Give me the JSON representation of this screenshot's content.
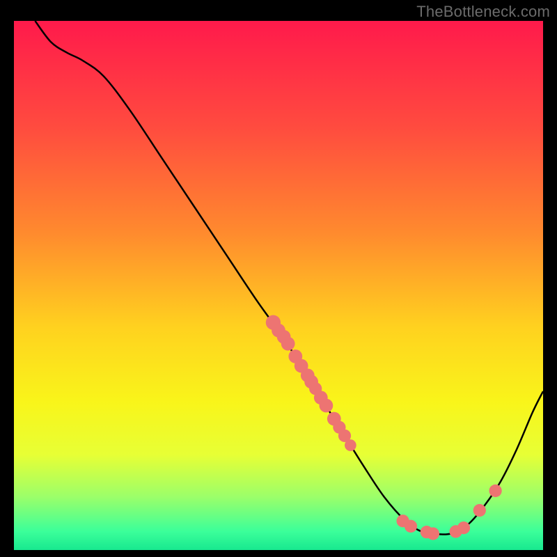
{
  "attribution": "TheBottleneck.com",
  "chart_data": {
    "type": "line",
    "title": "",
    "xlabel": "",
    "ylabel": "",
    "xlim": [
      0,
      100
    ],
    "ylim": [
      0,
      100
    ],
    "background_gradient": {
      "stops": [
        {
          "offset": 0.0,
          "color": "#ff1a4b"
        },
        {
          "offset": 0.2,
          "color": "#ff4b3f"
        },
        {
          "offset": 0.4,
          "color": "#ff8a2e"
        },
        {
          "offset": 0.58,
          "color": "#ffd21f"
        },
        {
          "offset": 0.72,
          "color": "#f9f51a"
        },
        {
          "offset": 0.82,
          "color": "#e7ff35"
        },
        {
          "offset": 0.9,
          "color": "#9bff6a"
        },
        {
          "offset": 0.965,
          "color": "#3bff9a"
        },
        {
          "offset": 1.0,
          "color": "#18e88f"
        }
      ]
    },
    "curve": [
      {
        "x": 4,
        "y": 100
      },
      {
        "x": 7,
        "y": 96
      },
      {
        "x": 10,
        "y": 94
      },
      {
        "x": 13,
        "y": 92.5
      },
      {
        "x": 17,
        "y": 89.5
      },
      {
        "x": 22,
        "y": 83
      },
      {
        "x": 28,
        "y": 74
      },
      {
        "x": 34,
        "y": 65
      },
      {
        "x": 40,
        "y": 56
      },
      {
        "x": 46,
        "y": 47
      },
      {
        "x": 51,
        "y": 40
      },
      {
        "x": 56,
        "y": 32
      },
      {
        "x": 61,
        "y": 24
      },
      {
        "x": 66,
        "y": 16
      },
      {
        "x": 70,
        "y": 10
      },
      {
        "x": 74,
        "y": 5.5
      },
      {
        "x": 77,
        "y": 3.5
      },
      {
        "x": 80,
        "y": 3
      },
      {
        "x": 83,
        "y": 3.2
      },
      {
        "x": 86,
        "y": 5
      },
      {
        "x": 89,
        "y": 8.5
      },
      {
        "x": 92,
        "y": 13
      },
      {
        "x": 95,
        "y": 19
      },
      {
        "x": 98,
        "y": 26
      },
      {
        "x": 100,
        "y": 30
      }
    ],
    "dots": [
      {
        "x": 49.0,
        "y": 43.0,
        "r": 1.4
      },
      {
        "x": 50.0,
        "y": 41.5,
        "r": 1.3
      },
      {
        "x": 51.0,
        "y": 40.3,
        "r": 1.3
      },
      {
        "x": 51.8,
        "y": 39.0,
        "r": 1.3
      },
      {
        "x": 53.2,
        "y": 36.6,
        "r": 1.3
      },
      {
        "x": 54.3,
        "y": 34.8,
        "r": 1.3
      },
      {
        "x": 55.5,
        "y": 33.0,
        "r": 1.3
      },
      {
        "x": 56.2,
        "y": 31.8,
        "r": 1.3
      },
      {
        "x": 57.0,
        "y": 30.5,
        "r": 1.2
      },
      {
        "x": 58.0,
        "y": 28.8,
        "r": 1.3
      },
      {
        "x": 59.0,
        "y": 27.3,
        "r": 1.3
      },
      {
        "x": 60.5,
        "y": 24.8,
        "r": 1.3
      },
      {
        "x": 61.5,
        "y": 23.2,
        "r": 1.2
      },
      {
        "x": 62.5,
        "y": 21.6,
        "r": 1.2
      },
      {
        "x": 63.6,
        "y": 19.8,
        "r": 1.1
      },
      {
        "x": 73.5,
        "y": 5.5,
        "r": 1.2
      },
      {
        "x": 75.0,
        "y": 4.5,
        "r": 1.2
      },
      {
        "x": 78.0,
        "y": 3.4,
        "r": 1.2
      },
      {
        "x": 79.2,
        "y": 3.1,
        "r": 1.2
      },
      {
        "x": 83.5,
        "y": 3.5,
        "r": 1.2
      },
      {
        "x": 85.0,
        "y": 4.2,
        "r": 1.2
      },
      {
        "x": 88.0,
        "y": 7.5,
        "r": 1.2
      },
      {
        "x": 91.0,
        "y": 11.2,
        "r": 1.2
      }
    ]
  }
}
